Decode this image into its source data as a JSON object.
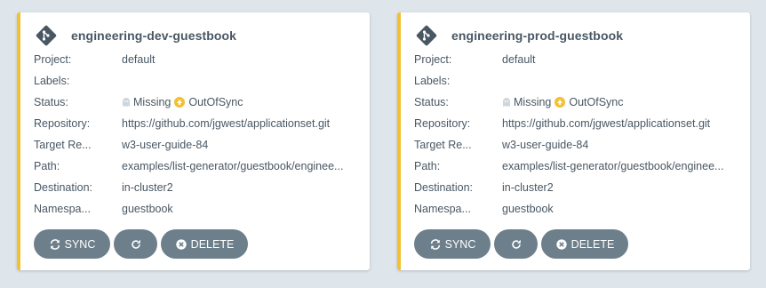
{
  "colors": {
    "accent": "#f4c030",
    "button": "#6d7f8b",
    "background": "#dee6eb"
  },
  "icons": {
    "app": "git-icon",
    "missing": "ghost-icon",
    "outofsync": "arrow-circle-up-icon",
    "sync": "sync-icon",
    "refresh": "redo-icon",
    "delete": "times-circle-icon"
  },
  "labels": {
    "project": "Project:",
    "labels": "Labels:",
    "status": "Status:",
    "repository": "Repository:",
    "target_revision": "Target Re...",
    "path": "Path:",
    "destination": "Destination:",
    "namespace": "Namespa..."
  },
  "buttons": {
    "sync": "SYNC",
    "delete": "DELETE"
  },
  "apps": [
    {
      "name": "engineering-dev-guestbook",
      "project": "default",
      "labels": "",
      "health": "Missing",
      "sync": "OutOfSync",
      "repository": "https://github.com/jgwest/applicationset.git",
      "target_revision": "w3-user-guide-84",
      "path": "examples/list-generator/guestbook/enginee...",
      "destination": "in-cluster2",
      "namespace": "guestbook"
    },
    {
      "name": "engineering-prod-guestbook",
      "project": "default",
      "labels": "",
      "health": "Missing",
      "sync": "OutOfSync",
      "repository": "https://github.com/jgwest/applicationset.git",
      "target_revision": "w3-user-guide-84",
      "path": "examples/list-generator/guestbook/enginee...",
      "destination": "in-cluster2",
      "namespace": "guestbook"
    }
  ]
}
